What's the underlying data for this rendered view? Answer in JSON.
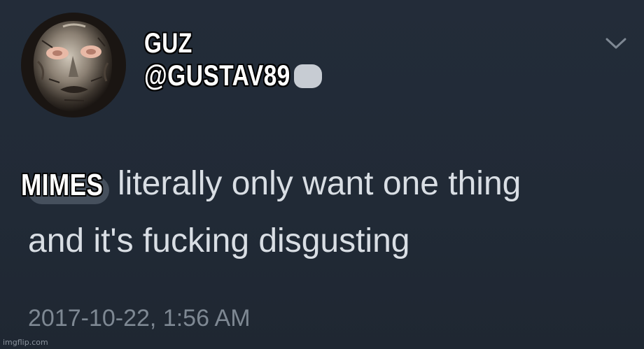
{
  "tweet": {
    "display_name": "GUZ",
    "handle": "@GUSTAV89",
    "subject": "MIMES",
    "text_line1": "literally only want one thing",
    "text_line2": "and it's fucking disgusting",
    "timestamp": "2017-10-22, 1:56 AM"
  },
  "icons": {
    "avatar": "metal-mask-avatar-icon",
    "menu": "chevron-down-icon"
  },
  "watermark": "imgflip.com",
  "colors": {
    "background": "#222a36",
    "text": "#d9dee4",
    "timestamp": "#7e8893",
    "caption": "#ffffff"
  }
}
